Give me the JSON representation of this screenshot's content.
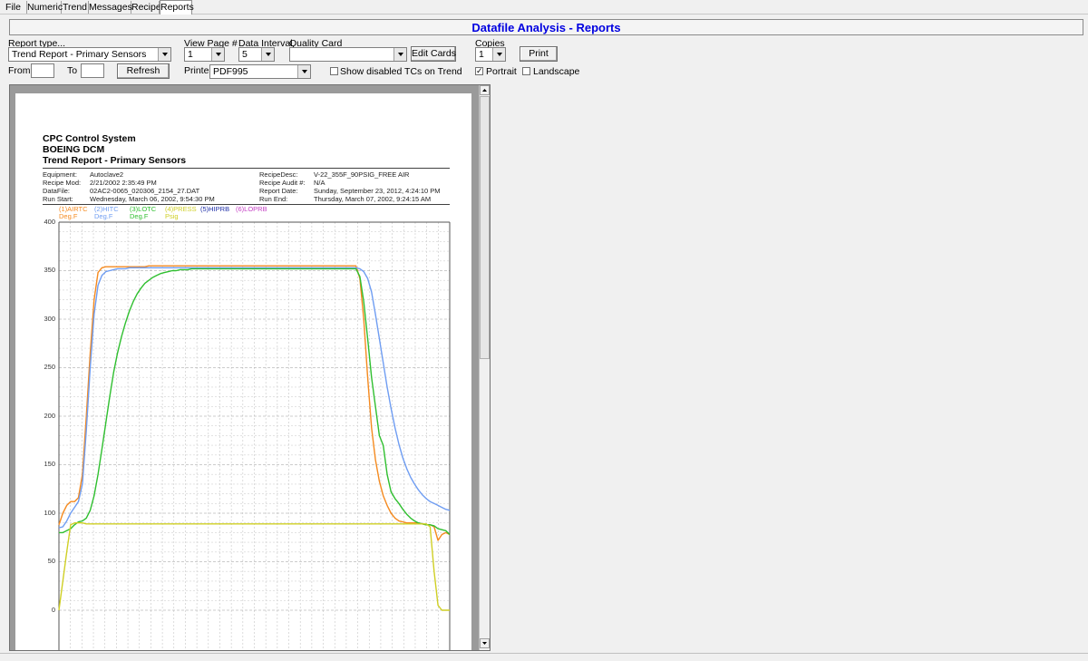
{
  "tabs": [
    "File",
    "Numeric",
    "Trend",
    "Messages",
    "Recipe",
    "Reports"
  ],
  "title": "Datafile Analysis - Reports",
  "controls": {
    "report_type_label": "Report type...",
    "report_type_value": "Trend Report - Primary Sensors",
    "from_label": "From",
    "to_label": "To",
    "refresh": "Refresh",
    "view_page_label": "View Page #",
    "view_page_value": "1",
    "data_interval_label": "Data Interval",
    "data_interval_value": "5",
    "quality_card_label": "Quality Card",
    "quality_card_value": "",
    "edit_cards": "Edit Cards",
    "printer_label": "Printer",
    "printer_value": "PDF995",
    "show_disabled": "Show disabled TCs on Trend",
    "show_disabled_checked": false,
    "copies_label": "Copies",
    "copies_value": "1",
    "print": "Print",
    "portrait": "Portrait",
    "portrait_checked": true,
    "landscape": "Landscape",
    "landscape_checked": false
  },
  "report": {
    "title_lines": [
      "CPC Control System",
      "BOEING DCM",
      "Trend Report - Primary Sensors"
    ],
    "left_info": [
      {
        "label": "Equipment:",
        "value": "Autoclave2"
      },
      {
        "label": "Recipe Mod:",
        "value": "2/21/2002 2:35:49 PM"
      },
      {
        "label": "DataFile:",
        "value": "02AC2-0065_020306_2154_27.DAT"
      },
      {
        "label": "Run Start:",
        "value": "Wednesday, March 06, 2002, 9:54:30 PM"
      }
    ],
    "right_info": [
      {
        "label": "RecipeDesc:",
        "value": "V-22_355F_90PSIG_FREE AIR"
      },
      {
        "label": "Recipe Audit #:",
        "value": "N/A"
      },
      {
        "label": "Report Date:",
        "value": "Sunday, September 23, 2012, 4:24:10 PM"
      },
      {
        "label": "Run End:",
        "value": "Thursday, March 07, 2002, 9:24:15 AM"
      }
    ]
  },
  "chart_data": {
    "type": "line",
    "title": "",
    "xlabel": "",
    "ylabel": "",
    "ylim": [
      0,
      400
    ],
    "y_ticks": [
      0,
      50,
      100,
      150,
      200,
      250,
      300,
      350,
      400
    ],
    "grid": true,
    "legend_position": "top-left",
    "x": [
      0,
      1,
      2,
      3,
      4,
      5,
      6,
      7,
      8,
      9,
      10,
      11,
      12,
      13,
      14,
      15,
      16,
      17,
      18,
      19,
      20,
      21,
      22,
      23,
      24,
      25,
      26,
      27,
      28,
      29,
      30,
      31,
      32,
      33,
      34,
      35,
      36,
      37,
      38,
      39,
      40,
      41,
      42,
      43,
      44,
      45,
      46,
      47,
      48,
      49,
      50,
      51,
      52,
      53,
      54,
      55,
      56,
      57,
      58,
      59,
      60,
      61,
      62,
      63,
      64,
      65,
      66,
      67,
      68,
      69,
      70,
      71,
      72,
      73,
      74,
      75,
      76,
      77,
      78,
      79,
      80,
      81,
      82,
      83,
      84,
      85,
      86,
      87,
      88,
      89,
      90,
      91,
      92,
      93,
      94,
      95,
      96,
      97,
      98,
      99,
      100
    ],
    "series": [
      {
        "name": "(1)AIRTC",
        "unit": "Deg.F",
        "color": "#f58a1f",
        "values": [
          88,
          100,
          108,
          112,
          112,
          116,
          140,
          200,
          265,
          320,
          348,
          353,
          354,
          354,
          354,
          354,
          354,
          354,
          354,
          354,
          354,
          354,
          354,
          355,
          355,
          355,
          355,
          355,
          355,
          355,
          355,
          355,
          355,
          355,
          355,
          355,
          355,
          355,
          355,
          355,
          355,
          355,
          355,
          355,
          355,
          355,
          355,
          355,
          355,
          355,
          355,
          355,
          355,
          355,
          355,
          355,
          355,
          355,
          355,
          355,
          355,
          355,
          355,
          355,
          355,
          355,
          355,
          355,
          355,
          355,
          355,
          355,
          355,
          355,
          355,
          355,
          355,
          342,
          300,
          240,
          188,
          155,
          133,
          118,
          108,
          100,
          95,
          92,
          91,
          90,
          90,
          90,
          90,
          89,
          88,
          88,
          86,
          72,
          78,
          80,
          78
        ]
      },
      {
        "name": "(2)HITC",
        "unit": "Deg.F",
        "color": "#6f9df2",
        "values": [
          85,
          86,
          92,
          100,
          106,
          112,
          130,
          185,
          250,
          305,
          335,
          345,
          349,
          350,
          351,
          352,
          352,
          352,
          353,
          353,
          353,
          353,
          353,
          353,
          353,
          353,
          353,
          353,
          353,
          353,
          353,
          353,
          353,
          353,
          353,
          353,
          353,
          353,
          353,
          353,
          353,
          353,
          353,
          353,
          353,
          353,
          353,
          353,
          353,
          353,
          353,
          353,
          353,
          353,
          353,
          353,
          353,
          353,
          353,
          353,
          353,
          353,
          353,
          353,
          353,
          353,
          353,
          353,
          353,
          353,
          353,
          353,
          353,
          353,
          353,
          353,
          353,
          352,
          349,
          342,
          328,
          305,
          280,
          255,
          230,
          208,
          188,
          171,
          157,
          146,
          137,
          130,
          124,
          119,
          115,
          112,
          110,
          108,
          106,
          104,
          103
        ]
      },
      {
        "name": "(3)LOTC",
        "unit": "Deg.F",
        "color": "#2fbf2f",
        "values": [
          80,
          80,
          82,
          84,
          88,
          91,
          92,
          95,
          103,
          118,
          140,
          166,
          193,
          220,
          245,
          265,
          282,
          296,
          308,
          318,
          326,
          332,
          337,
          340,
          343,
          345,
          347,
          348,
          349,
          350,
          350,
          351,
          351,
          351,
          352,
          352,
          352,
          352,
          352,
          352,
          352,
          352,
          352,
          352,
          352,
          352,
          352,
          352,
          352,
          352,
          352,
          352,
          352,
          352,
          352,
          352,
          352,
          352,
          352,
          352,
          352,
          352,
          352,
          352,
          352,
          352,
          352,
          352,
          352,
          352,
          352,
          352,
          352,
          352,
          352,
          352,
          352,
          344,
          318,
          280,
          240,
          210,
          180,
          170,
          140,
          122,
          115,
          110,
          104,
          99,
          95,
          92,
          90,
          89,
          88,
          88,
          87,
          84,
          83,
          82,
          78
        ]
      },
      {
        "name": "(4)PRESS",
        "unit": "Psig",
        "color": "#cfcf24",
        "values": [
          0,
          30,
          60,
          88,
          90,
          90,
          90,
          89,
          89,
          89,
          89,
          89,
          89,
          89,
          89,
          89,
          89,
          89,
          89,
          89,
          89,
          89,
          89,
          89,
          89,
          89,
          89,
          89,
          89,
          89,
          89,
          89,
          89,
          89,
          89,
          89,
          89,
          89,
          89,
          89,
          89,
          89,
          89,
          89,
          89,
          89,
          89,
          89,
          89,
          89,
          89,
          89,
          89,
          89,
          89,
          89,
          89,
          89,
          89,
          89,
          89,
          89,
          89,
          89,
          89,
          89,
          89,
          89,
          89,
          89,
          89,
          89,
          89,
          89,
          89,
          89,
          89,
          89,
          89,
          89,
          89,
          89,
          89,
          89,
          89,
          89,
          89,
          89,
          89,
          89,
          89,
          89,
          89,
          89,
          89,
          86,
          40,
          5,
          0,
          0,
          0
        ]
      },
      {
        "name": "(5)HIPRB",
        "unit": "",
        "color": "#1f2fa8",
        "values": []
      },
      {
        "name": "(6)LOPRB",
        "unit": "",
        "color": "#c43fc4",
        "values": []
      }
    ]
  },
  "colors": {
    "title": "#0000e0",
    "viewer_bg": "#9a9a9a",
    "page_bg": "#ffffff"
  }
}
